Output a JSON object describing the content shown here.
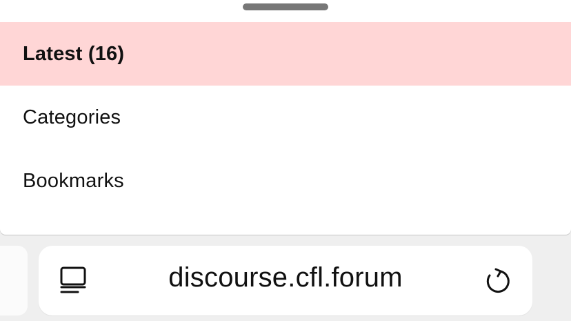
{
  "menu": {
    "items": [
      {
        "label": "Latest (16)",
        "active": true
      },
      {
        "label": "Categories",
        "active": false
      },
      {
        "label": "Bookmarks",
        "active": false
      }
    ]
  },
  "browser": {
    "url": "discourse.cfl.forum",
    "left_icon": "reader-icon",
    "right_icon": "reload-icon"
  },
  "colors": {
    "active_item_bg": "#ffd6d6",
    "sheet_bg": "#ffffff",
    "page_bg": "#efefef",
    "grabber": "#777777"
  }
}
